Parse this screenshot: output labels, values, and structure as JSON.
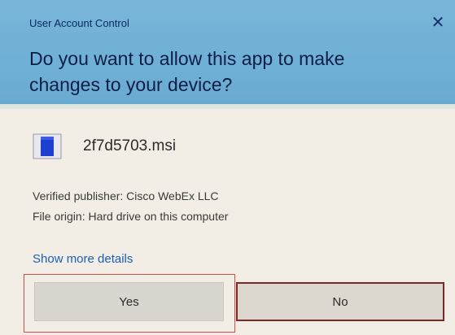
{
  "window": {
    "title": "User Account Control",
    "close_icon": "close-icon"
  },
  "prompt": {
    "question": "Do you want to allow this app to make changes to your device?"
  },
  "file": {
    "icon": "msi-package-icon",
    "name": "2f7d5703.msi"
  },
  "info": {
    "publisher": "Verified publisher: Cisco WebEx LLC",
    "origin": "File origin: Hard drive on this computer"
  },
  "links": {
    "details": "Show more details"
  },
  "buttons": {
    "yes": "Yes",
    "no": "No"
  },
  "colors": {
    "header": "#6fb0d6",
    "body": "#f2eee6",
    "link": "#1a5fb4",
    "no_border": "#7a2a26",
    "highlight": "#d94a4a"
  }
}
